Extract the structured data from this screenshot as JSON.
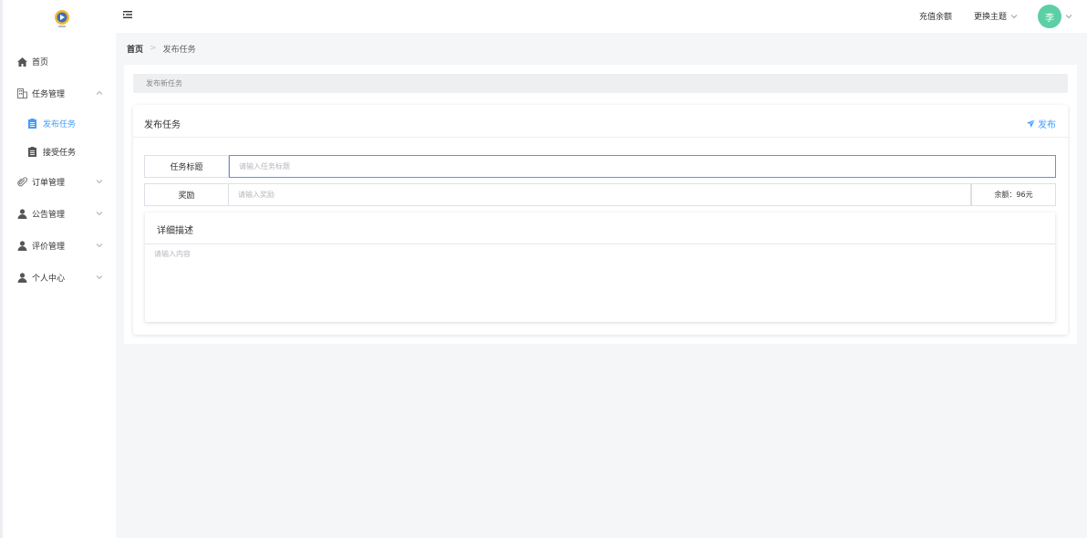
{
  "colors": {
    "accent": "#409eff",
    "avatar_bg": "#5ccfa5"
  },
  "sidebar": {
    "items": [
      {
        "label": "首页",
        "icon": "home-icon",
        "chevron": false
      },
      {
        "label": "任务管理",
        "icon": "building-icon",
        "chevron": "up",
        "children": [
          {
            "label": "发布任务",
            "icon": "document-icon",
            "active": true
          },
          {
            "label": "接受任务",
            "icon": "document-icon",
            "active": false
          }
        ]
      },
      {
        "label": "订单管理",
        "icon": "paperclip-icon",
        "chevron": "down"
      },
      {
        "label": "公告管理",
        "icon": "user-icon",
        "chevron": "down"
      },
      {
        "label": "评价管理",
        "icon": "user-icon",
        "chevron": "down"
      },
      {
        "label": "个人中心",
        "icon": "user-icon",
        "chevron": "down"
      }
    ]
  },
  "header": {
    "recharge_label": "充值余额",
    "theme_label": "更换主题",
    "avatar_text": "李"
  },
  "breadcrumb": {
    "home": "首页",
    "current": "发布任务"
  },
  "main": {
    "section_bar": "发布新任务",
    "card_title": "发布任务",
    "publish_label": "发布",
    "form": {
      "title_label": "任务标题",
      "title_placeholder": "请输入任务标题",
      "reward_label": "奖励",
      "reward_placeholder": "请输入奖励",
      "balance_text": "余额：96元",
      "desc_title": "详细描述",
      "desc_placeholder": "请输入内容"
    }
  }
}
